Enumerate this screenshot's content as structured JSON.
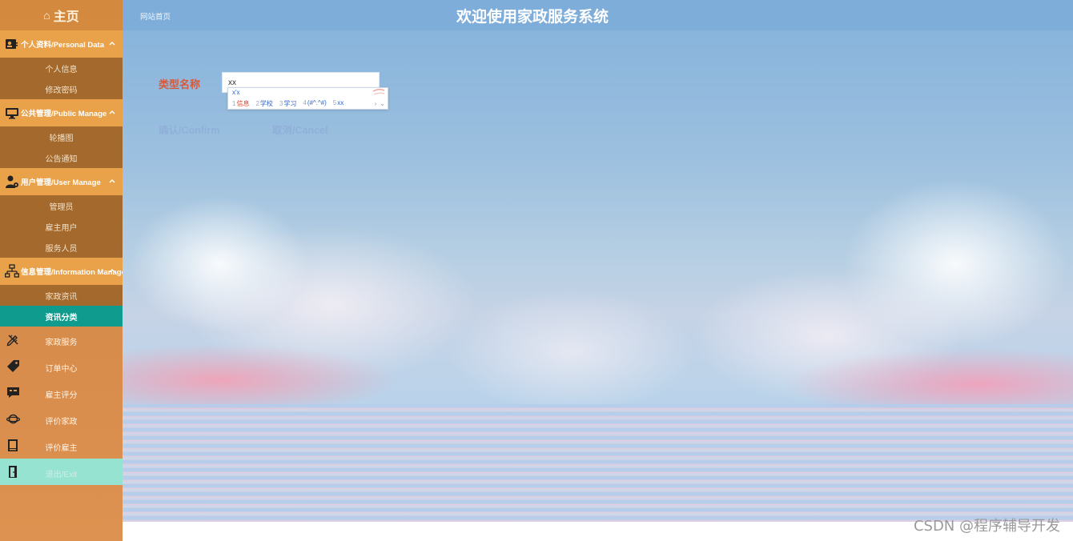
{
  "sidebar": {
    "home_label": "主页",
    "groups": [
      {
        "label": "个人资料/Personal Data",
        "icon": "user-card-icon",
        "items": [
          {
            "label": "个人信息"
          },
          {
            "label": "修改密码"
          }
        ]
      },
      {
        "label": "公共管理/Public Manage",
        "icon": "monitor-icon",
        "items": [
          {
            "label": "轮播图"
          },
          {
            "label": "公告通知"
          }
        ]
      },
      {
        "label": "用户管理/User Manage",
        "icon": "user-gear-icon",
        "items": [
          {
            "label": "管理员"
          },
          {
            "label": "雇主用户"
          },
          {
            "label": "服务人员"
          }
        ]
      },
      {
        "label": "信息管理/Information Manage",
        "icon": "hierarchy-icon",
        "items": [
          {
            "label": "家政资讯"
          },
          {
            "label": "资讯分类",
            "active": true
          }
        ]
      }
    ],
    "items": [
      {
        "label": "家政服务",
        "icon": "pencil-ruler-icon"
      },
      {
        "label": "订单中心",
        "icon": "tag-icon"
      },
      {
        "label": "雇主评分",
        "icon": "chat-icon"
      },
      {
        "label": "评价家政",
        "icon": "planet-icon"
      },
      {
        "label": "评价雇主",
        "icon": "book-icon"
      },
      {
        "label": "退出/Exit",
        "icon": "exit-door-icon"
      }
    ]
  },
  "header": {
    "breadcrumb": "网站首页",
    "title": "欢迎使用家政服务系统"
  },
  "form": {
    "label": "类型名称",
    "input_value": "xx",
    "confirm_label": "确认/Confirm",
    "cancel_label": "取消/Cancel"
  },
  "ime": {
    "composition": "x'x",
    "candidates": [
      {
        "num": "1",
        "text": "信息"
      },
      {
        "num": "2",
        "text": "学校"
      },
      {
        "num": "3",
        "text": "学习"
      },
      {
        "num": "4",
        "text": "(#^.^#)"
      },
      {
        "num": "5",
        "text": "xx"
      }
    ],
    "next": "›",
    "expand": "⌄"
  },
  "watermark": "CSDN @程序辅导开发",
  "colors": {
    "sidebar_bg": "#d48a3e",
    "group_bg": "#e9a24a",
    "submenu_bg": "#a3692d",
    "active_bg": "#0f9b8e",
    "exit_bg": "#96e3d2",
    "topbar_bg": "#7fadd9",
    "label_color": "#d8593a",
    "button_color": "#8fb0d8"
  }
}
